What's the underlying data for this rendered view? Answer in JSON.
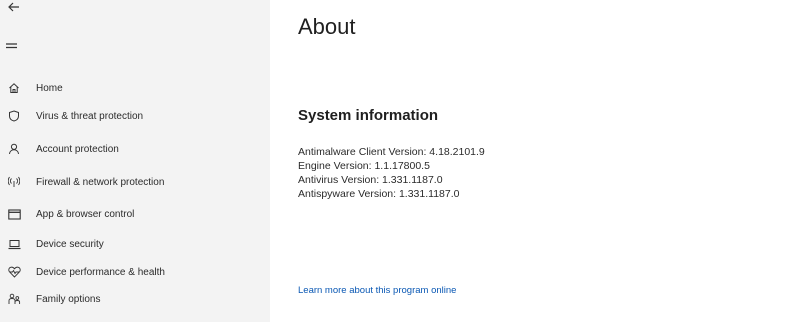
{
  "sidebar": {
    "back_icon": "back-arrow-icon",
    "menu_icon": "hamburger-menu-icon",
    "items": [
      {
        "label": "Home",
        "icon": "home-icon"
      },
      {
        "label": "Virus & threat protection",
        "icon": "shield-icon"
      },
      {
        "label": "Account protection",
        "icon": "person-icon"
      },
      {
        "label": "Firewall & network protection",
        "icon": "wifi-antenna-icon"
      },
      {
        "label": "App & browser control",
        "icon": "app-window-icon"
      },
      {
        "label": "Device security",
        "icon": "laptop-icon"
      },
      {
        "label": "Device performance & health",
        "icon": "heart-icon"
      },
      {
        "label": "Family options",
        "icon": "family-icon"
      }
    ]
  },
  "main": {
    "title": "About",
    "system_info": {
      "heading": "System information",
      "lines": [
        "Antimalware Client Version: 4.18.2101.9",
        "Engine Version: 1.1.17800.5",
        "Antivirus Version: 1.331.1187.0",
        "Antispyware Version: 1.331.1187.0"
      ]
    },
    "learn_more_link": "Learn more about this program online"
  },
  "colors": {
    "sidebar_bg": "#f3f3f3",
    "link": "#0a58b4",
    "text": "#1f1f1f"
  }
}
